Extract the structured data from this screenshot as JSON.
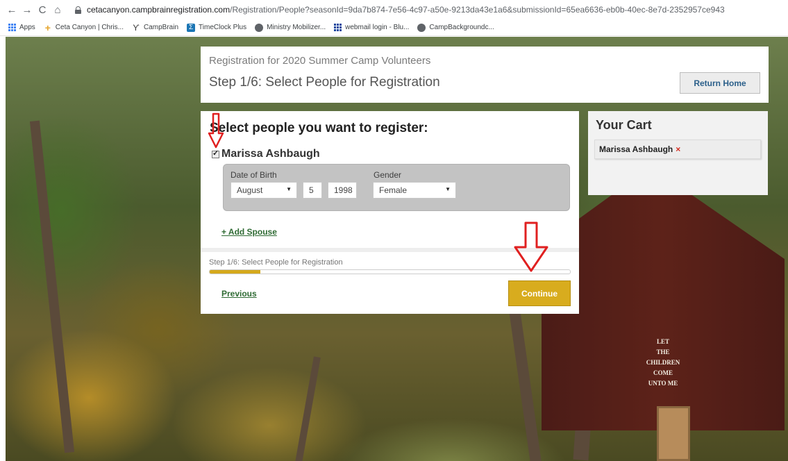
{
  "browser": {
    "url_host": "cetacanyon.campbrainregistration.com",
    "url_path": "/Registration/People?seasonId=9da7b874-7e56-4c97-a50e-9213da43e1a6&submissionId=65ea6636-eb0b-40ec-8e7d-2352957ce943",
    "bookmarks": [
      {
        "label": "Apps",
        "icon": "apps-grid-icon"
      },
      {
        "label": "Ceta Canyon | Chris...",
        "icon": "cross-icon"
      },
      {
        "label": "CampBrain",
        "icon": "campbrain-icon"
      },
      {
        "label": "TimeClock Plus",
        "icon": "timeclock-icon"
      },
      {
        "label": "Ministry Mobilizer...",
        "icon": "globe-icon"
      },
      {
        "label": "webmail login - Blu...",
        "icon": "grid-icon"
      },
      {
        "label": "CampBackgroundc...",
        "icon": "globe-icon"
      }
    ]
  },
  "header": {
    "registration_title": "Registration for 2020 Summer Camp Volunteers",
    "step_title": "Step 1/6: Select People for Registration",
    "return_home_label": "Return Home"
  },
  "main": {
    "heading": "Select people you want to register:",
    "person": {
      "name": "Marissa Ashbaugh",
      "checked": true,
      "dob_label": "Date of Birth",
      "month": "August",
      "day": "5",
      "year": "1998",
      "gender_label": "Gender",
      "gender": "Female"
    },
    "add_spouse_label": "+ Add Spouse",
    "progress_label": "Step 1/6: Select People for Registration",
    "progress_fraction": 0.14,
    "previous_label": "Previous",
    "continue_label": "Continue"
  },
  "cart": {
    "title": "Your Cart",
    "items": [
      {
        "name": "Marissa Ashbaugh",
        "remove": "×"
      }
    ]
  },
  "church_sign": [
    "LET",
    "THE CHILDREN",
    "COME",
    "UNTO ME"
  ],
  "colors": {
    "accent_gold": "#d8ac1e",
    "link_green": "#2f6b34",
    "annotation_red": "#e02020"
  }
}
